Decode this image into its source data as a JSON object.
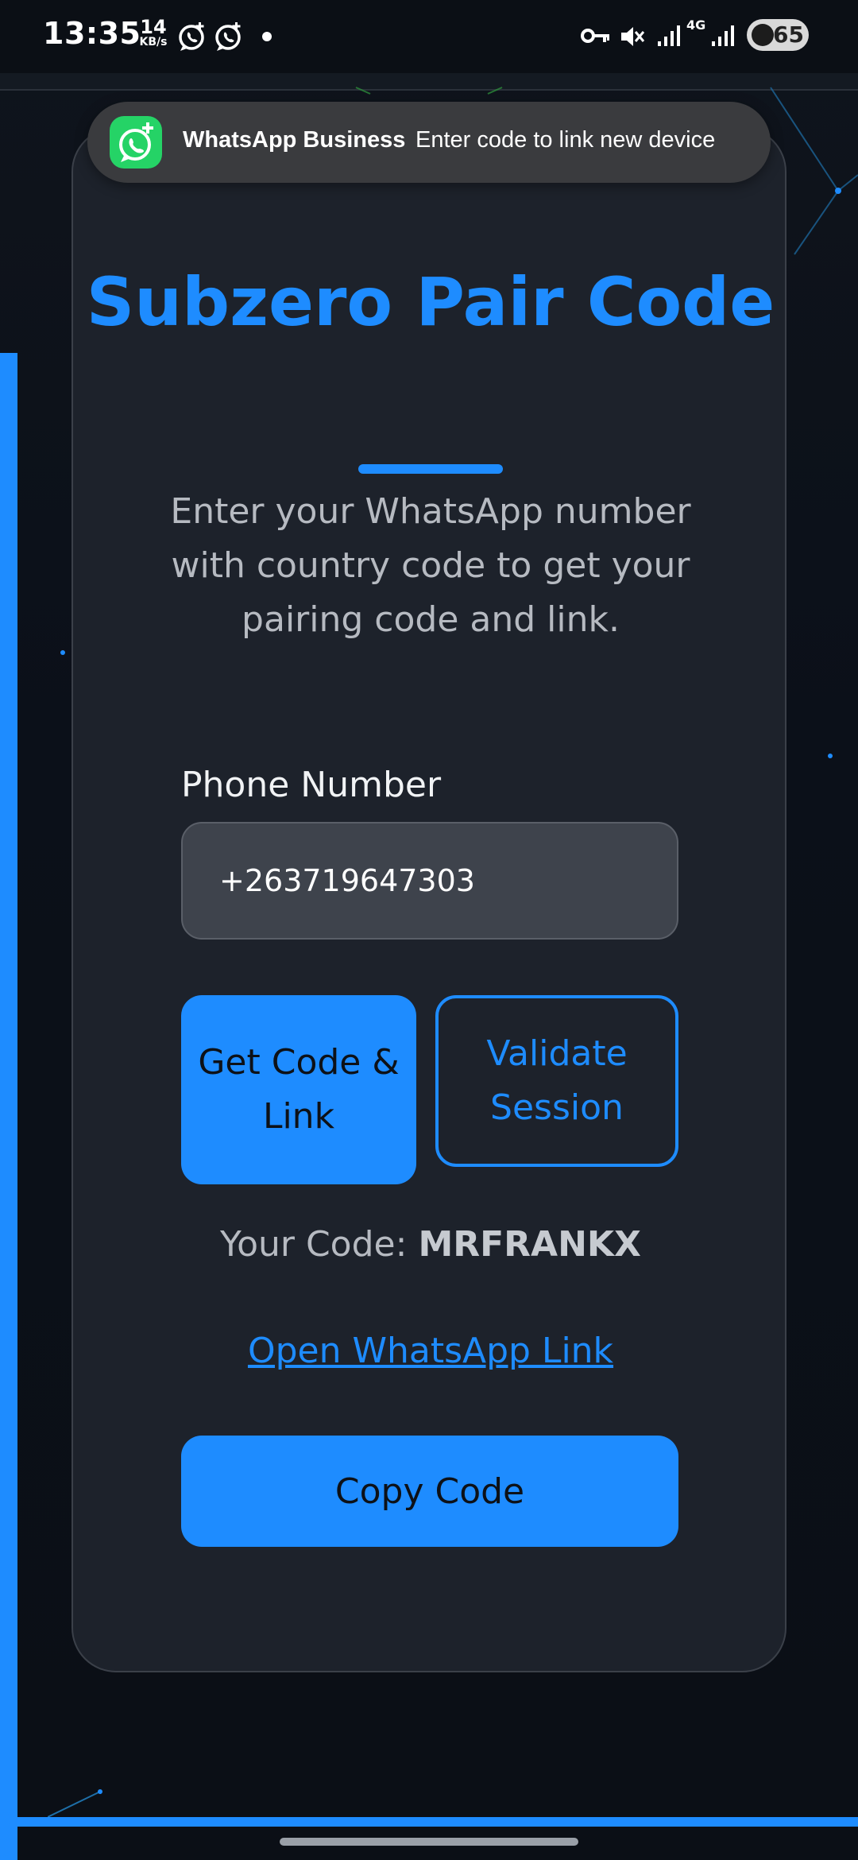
{
  "status_bar": {
    "time": "13:35",
    "net_speed_value": "14",
    "net_speed_unit": "KB/s",
    "network_type": "4G",
    "battery": "65"
  },
  "notification": {
    "app_name": "WhatsApp Business",
    "message": "Enter code to link new device"
  },
  "card": {
    "title": "Subzero Pair Code",
    "subtitle": "Enter your WhatsApp number with country code to get your pairing code and link.",
    "phone_label": "Phone Number",
    "phone_value": "+263719647303",
    "get_code_label": "Get Code & Link",
    "validate_label": "Validate Session",
    "code_prefix": "Your Code:",
    "code_value": "MRFRANKX",
    "open_link_label": "Open WhatsApp Link",
    "copy_label": "Copy Code"
  },
  "colors": {
    "accent": "#1e8cff",
    "card_bg": "#1d222b",
    "page_bg": "#0b0f16",
    "whatsapp_green": "#25d366"
  }
}
